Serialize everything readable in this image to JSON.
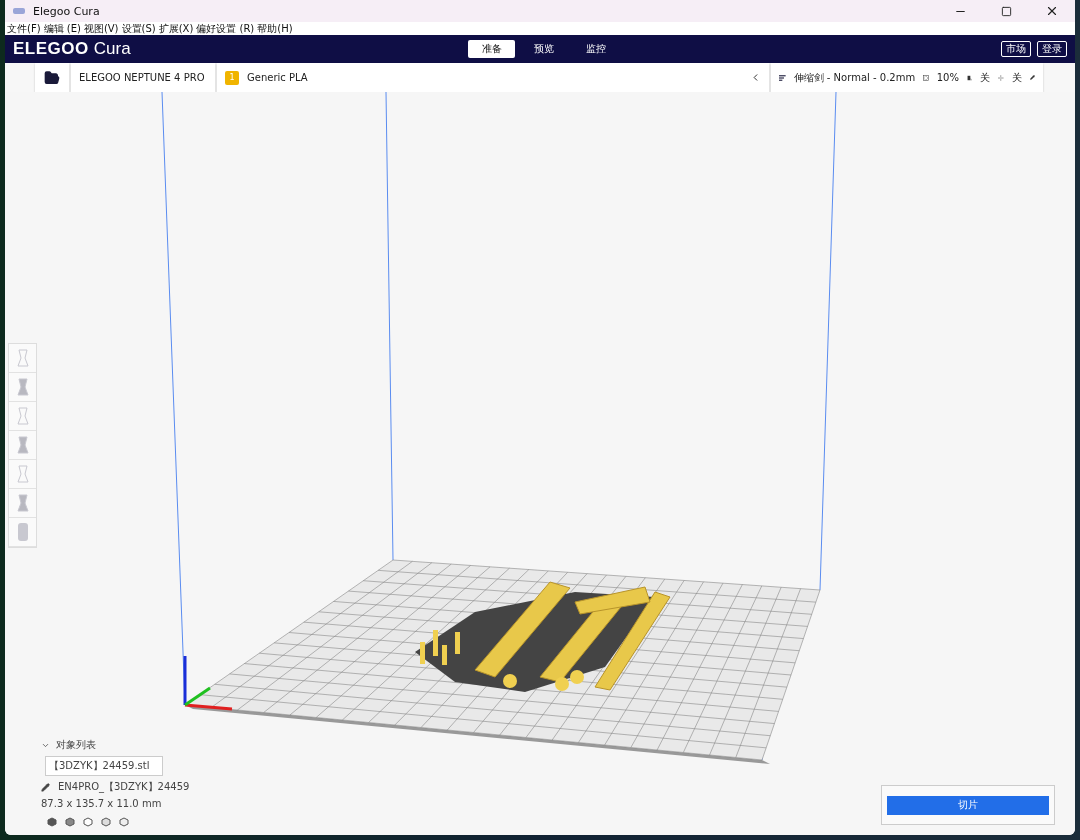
{
  "window": {
    "title": "Elegoo Cura"
  },
  "menu": [
    "文件(F)",
    "编辑 (E)",
    "视图(V)",
    "设置(S)",
    "扩展(X)",
    "偏好设置 (R)",
    "帮助(H)"
  ],
  "logo": {
    "brand": "ELEGOO",
    "product": "Cura"
  },
  "stages": [
    {
      "label": "准备",
      "selected": true
    },
    {
      "label": "预览",
      "selected": false
    },
    {
      "label": "监控",
      "selected": false
    }
  ],
  "header_buttons": [
    "市场",
    "登录"
  ],
  "printer": {
    "name": "ELEGOO NEPTUNE 4 PRO"
  },
  "material": {
    "extruder": "1",
    "name": "Generic PLA"
  },
  "print_settings": {
    "profile": "伸缩剑 - Normal - 0.2mm",
    "infill": "10%",
    "support": "关",
    "adhesion": "关"
  },
  "object_list": {
    "title": "对象列表",
    "expanded": true,
    "items": [
      "【3DZYK】24459.stl"
    ],
    "job_name": "EN4PRO_【3DZYK】24459",
    "dimensions": "87.3 x 135.7 x 11.0 mm"
  },
  "slice_button": "切片"
}
